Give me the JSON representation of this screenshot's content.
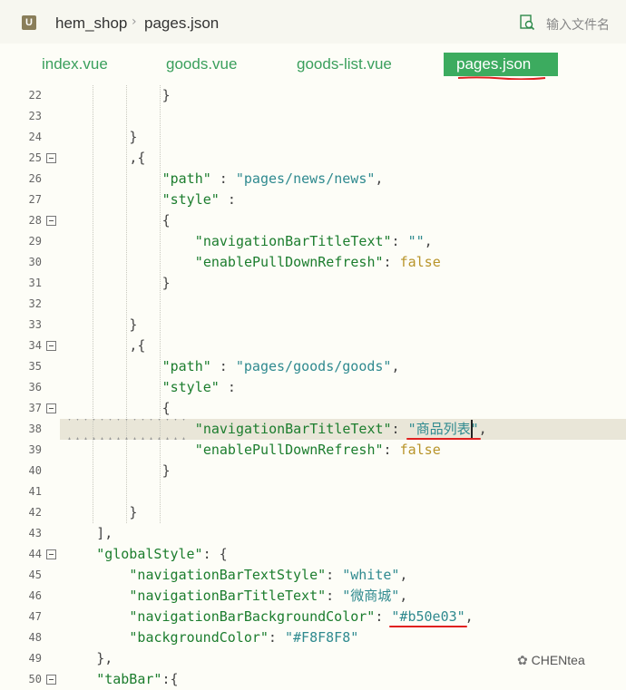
{
  "breadcrumb": {
    "app_icon": "U",
    "project": "hem_shop",
    "file": "pages.json"
  },
  "file_search": {
    "placeholder": "输入文件名"
  },
  "tabs": [
    {
      "label": "index.vue",
      "active": false
    },
    {
      "label": "goods.vue",
      "active": false
    },
    {
      "label": "goods-list.vue",
      "active": false
    },
    {
      "label": "pages.json",
      "active": true
    }
  ],
  "colors": {
    "tab_active": "#3cab5f",
    "key": "#1c7d2e",
    "string": "#2f8a8f",
    "boolean": "#b8942a",
    "annotation_red": "#e02020"
  },
  "editor": {
    "current_line": 38,
    "lines": [
      {
        "n": "22",
        "fold": false,
        "code": "}"
      },
      {
        "n": "23",
        "fold": false,
        "code": ""
      },
      {
        "n": "24",
        "fold": false,
        "code": "}"
      },
      {
        "n": "25",
        "fold": true,
        "code": ",{"
      },
      {
        "n": "26",
        "fold": false,
        "key": "\"path\"",
        "sep": " : ",
        "val": "\"pages/news/news\"",
        "tail": ","
      },
      {
        "n": "27",
        "fold": false,
        "key": "\"style\"",
        "sep": " :",
        "val": "",
        "tail": ""
      },
      {
        "n": "28",
        "fold": true,
        "code": "{"
      },
      {
        "n": "29",
        "fold": false,
        "key": "\"navigationBarTitleText\"",
        "sep": ": ",
        "val": "\"\"",
        "tail": ","
      },
      {
        "n": "30",
        "fold": false,
        "key": "\"enablePullDownRefresh\"",
        "sep": ": ",
        "bool": "false"
      },
      {
        "n": "31",
        "fold": false,
        "code": "}"
      },
      {
        "n": "32",
        "fold": false,
        "code": ""
      },
      {
        "n": "33",
        "fold": false,
        "code": "}"
      },
      {
        "n": "34",
        "fold": true,
        "code": ",{"
      },
      {
        "n": "35",
        "fold": false,
        "key": "\"path\"",
        "sep": " : ",
        "val": "\"pages/goods/goods\"",
        "tail": ","
      },
      {
        "n": "36",
        "fold": false,
        "key": "\"style\"",
        "sep": " :",
        "val": "",
        "tail": ""
      },
      {
        "n": "37",
        "fold": true,
        "code": "{"
      },
      {
        "n": "38",
        "fold": false,
        "key": "\"navigationBarTitleText\"",
        "sep": ": ",
        "val": "\"商品列表\"",
        "tail": ","
      },
      {
        "n": "39",
        "fold": false,
        "key": "\"enablePullDownRefresh\"",
        "sep": ": ",
        "bool": "false"
      },
      {
        "n": "40",
        "fold": false,
        "code": "}"
      },
      {
        "n": "41",
        "fold": false,
        "code": ""
      },
      {
        "n": "42",
        "fold": false,
        "code": "}"
      },
      {
        "n": "43",
        "fold": false,
        "code": "],"
      },
      {
        "n": "44",
        "fold": true,
        "key": "\"globalStyle\"",
        "sep": ": ",
        "code_tail": "{"
      },
      {
        "n": "45",
        "fold": false,
        "key": "\"navigationBarTextStyle\"",
        "sep": ": ",
        "val": "\"white\"",
        "tail": ","
      },
      {
        "n": "46",
        "fold": false,
        "key": "\"navigationBarTitleText\"",
        "sep": ": ",
        "val": "\"微商城\"",
        "tail": ","
      },
      {
        "n": "47",
        "fold": false,
        "key": "\"navigationBarBackgroundColor\"",
        "sep": ": ",
        "val": "\"#b50e03\"",
        "tail": ","
      },
      {
        "n": "48",
        "fold": false,
        "key": "\"backgroundColor\"",
        "sep": ": ",
        "val": "\"#F8F8F8\"",
        "tail": ""
      },
      {
        "n": "49",
        "fold": false,
        "code": "},"
      },
      {
        "n": "50",
        "fold": true,
        "key": "\"tabBar\"",
        "sep": ":",
        "code_tail": "{"
      }
    ]
  },
  "watermark": "CHENtea"
}
